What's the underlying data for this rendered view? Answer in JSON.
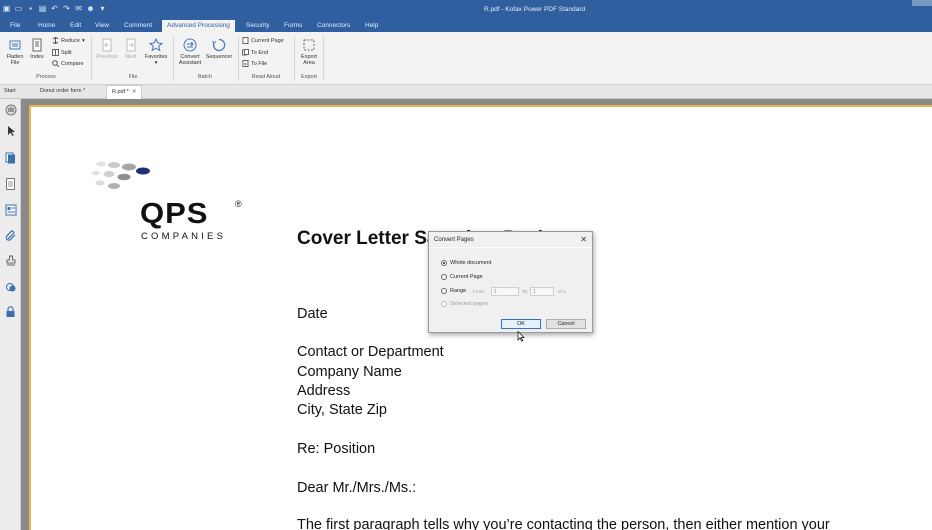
{
  "window": {
    "title": "R.pdf - Kofax Power PDF Standard"
  },
  "menu_tabs": [
    "File",
    "Home",
    "Edit",
    "View",
    "Comment",
    "Advanced Processing",
    "Security",
    "Forms",
    "Connectors",
    "Help"
  ],
  "ribbon": {
    "process": {
      "label": "Process",
      "flatten": "Flatten File",
      "index": "Index",
      "reduce": "Reduce",
      "split": "Split",
      "compare": "Compare"
    },
    "file": {
      "label": "File",
      "previous": "Previous",
      "next": "Next",
      "favorites": "Favorites"
    },
    "batch": {
      "label": "Batch",
      "convert_assistant": "Convert Assistant",
      "sequencer": "Sequencer"
    },
    "read_aloud": {
      "label": "Read Aloud",
      "current_page": "Current Page",
      "to_end": "To End",
      "to_file": "To File"
    },
    "export": {
      "label": "Export",
      "export_area": "Export Area"
    }
  },
  "doc_tabs": {
    "start": "Start",
    "donut": "Donut order form *",
    "rpdf": "R.pdf *"
  },
  "document": {
    "logo_word": "QPS",
    "logo_reg": "®",
    "logo_sub": "COMPANIES",
    "title": "Cover Letter Sample – Basic",
    "date": "Date",
    "contact": "Contact or Department",
    "company": "Company Name",
    "address": "Address",
    "city": "City, State Zip",
    "re": "Re:  Position",
    "salutation": "Dear Mr./Mrs./Ms.:",
    "paragraph": "The first paragraph tells why you’re contacting the person, then either mention your"
  },
  "dialog": {
    "title": "Convert Pages",
    "close": "✕",
    "whole_document": "Whole document",
    "current_page": "Current Page",
    "range": "Range",
    "from_label": "From:",
    "from_value": "1",
    "to_label": "To:",
    "to_value": "1",
    "of_label": "of 1",
    "selected_pages": "Selected pages",
    "ok": "OK",
    "cancel": "Cancel"
  },
  "colors": {
    "title_bar": "#2f5f9e",
    "page_highlight": "#e7b94a"
  }
}
